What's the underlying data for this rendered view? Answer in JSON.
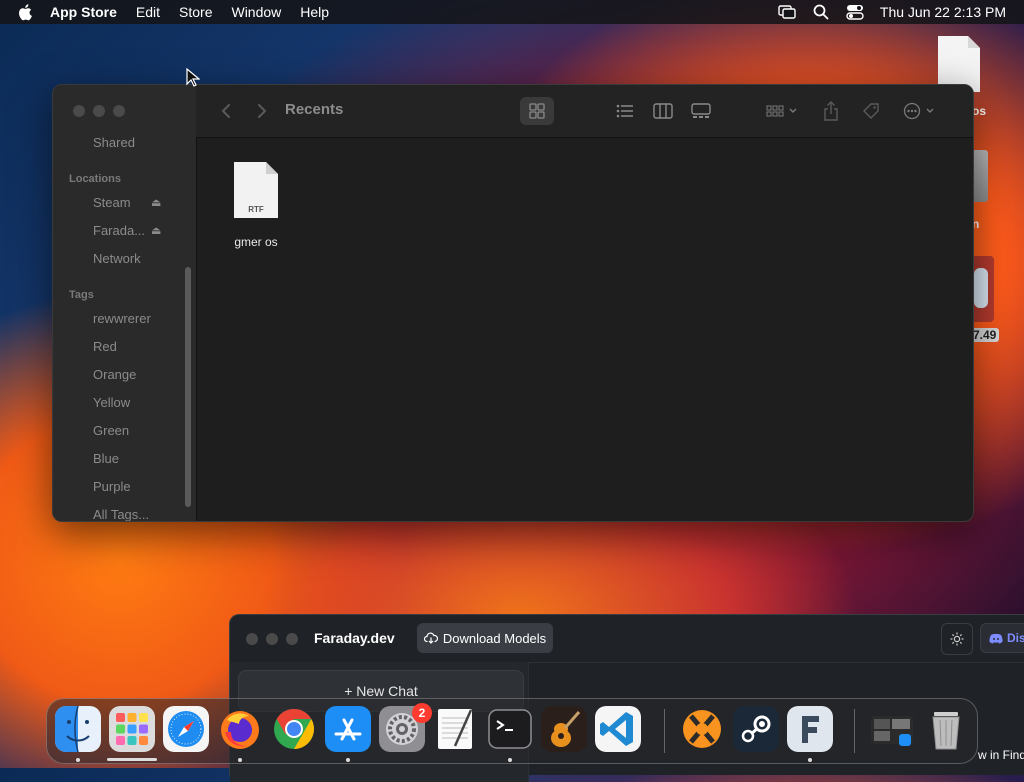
{
  "menubar": {
    "app_name": "App Store",
    "items": [
      "Edit",
      "Store",
      "Window",
      "Help"
    ],
    "clock": "Thu Jun 22  2:13 PM"
  },
  "finder": {
    "title": "Recents",
    "sidebar": {
      "shared_item": "Shared",
      "locations_heading": "Locations",
      "locations": [
        "Steam",
        "Farada...",
        "Network"
      ],
      "tags_heading": "Tags",
      "tags": [
        "rewwrerer",
        "Red",
        "Orange",
        "Yellow",
        "Green",
        "Blue",
        "Purple",
        "All Tags..."
      ]
    },
    "files": [
      {
        "name": "gmer os",
        "type_label": "RTF"
      }
    ]
  },
  "desktop": {
    "label_1": "os",
    "label_2": "n",
    "label_3": "7.49"
  },
  "faraday": {
    "title": "Faraday.dev",
    "download_label": "Download Models",
    "discord_label": "Dis",
    "new_chat_label": "+ New Chat"
  },
  "dock": {
    "badge_count": "2",
    "apps": [
      "Finder",
      "Launchpad",
      "Safari",
      "Firefox",
      "Chrome",
      "App Store",
      "System Settings",
      "TextEdit",
      "Terminal",
      "GarageBand",
      "VS Code",
      "CrossOver",
      "Steam",
      "Faraday",
      "Desktop Folder",
      "Trash"
    ]
  },
  "finder_hint": "w in Finde"
}
